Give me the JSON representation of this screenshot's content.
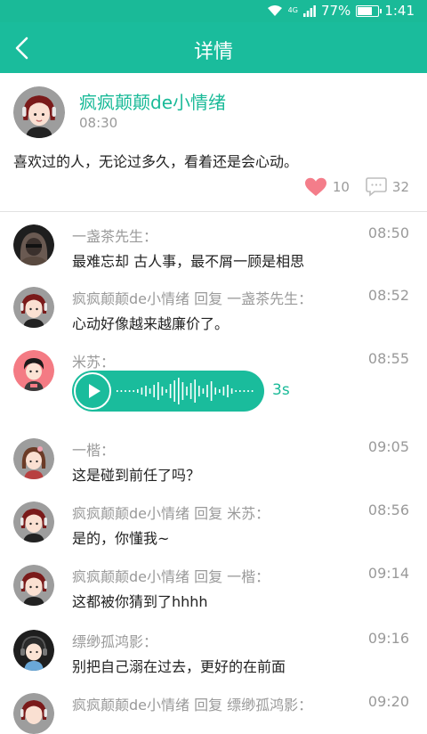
{
  "status_bar": {
    "battery": "77%",
    "time": "1:41",
    "battery_level": 0.77
  },
  "header": {
    "title": "详情"
  },
  "post": {
    "author": "疯疯颠颠de小情绪",
    "time": "08:30",
    "content": "喜欢过的人，无论过多久，看着还是会心动。",
    "likes": "10",
    "comments": "32"
  },
  "comments": [
    {
      "name": "一盏茶先生：",
      "time": "08:50",
      "text": "最难忘却 古人事，最不屑一顾是相思",
      "avatar": "hood"
    },
    {
      "name": "疯疯颠颠de小情绪 回复 一盏茶先生：",
      "time": "08:52",
      "text": "心动好像越来越廉价了。",
      "avatar": "girl"
    },
    {
      "name": "米苏：",
      "time": "08:55",
      "voice_duration": "3s",
      "avatar": "boy-pink"
    },
    {
      "name": "一楷：",
      "time": "09:05",
      "text": "这是碰到前任了吗？",
      "avatar": "girl2"
    },
    {
      "name": "疯疯颠颠de小情绪 回复 米苏：",
      "time": "08:56",
      "text": "是的，你懂我~",
      "avatar": "girl"
    },
    {
      "name": "疯疯颠颠de小情绪 回复 一楷：",
      "time": "09:14",
      "text": "这都被你猜到了hhhh",
      "avatar": "girl"
    },
    {
      "name": "缥缈孤鸿影：",
      "time": "09:16",
      "text": "别把自己溺在过去，更好的在前面",
      "avatar": "boy-headphone"
    },
    {
      "name": "疯疯颠颠de小情绪 回复 缥缈孤鸿影：",
      "time": "09:20",
      "avatar": "girl"
    }
  ]
}
